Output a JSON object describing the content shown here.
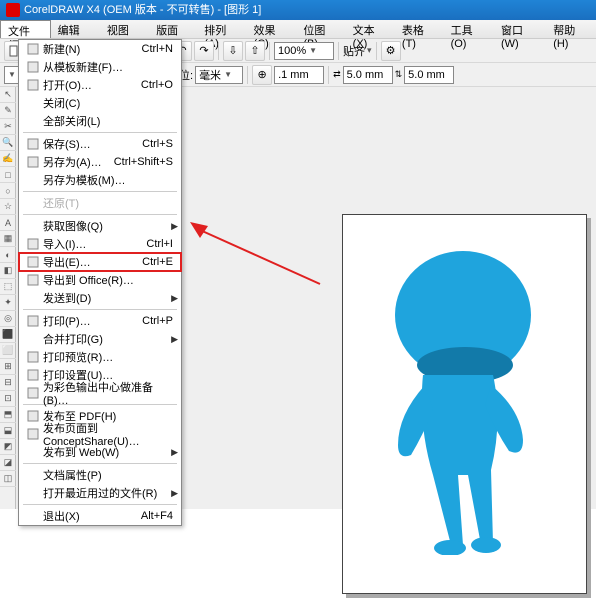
{
  "title": "CorelDRAW X4 (OEM 版本 - 不可转售) - [图形 1]",
  "menubar": [
    "文件(F)",
    "编辑(E)",
    "视图(V)",
    "版面(L)",
    "排列(A)",
    "效果(C)",
    "位图(B)",
    "文本(X)",
    "表格(T)",
    "工具(O)",
    "窗口(W)",
    "帮助(H)"
  ],
  "toolbar1": {
    "zoom": "100%",
    "align_label": "贴齐"
  },
  "toolbar2": {
    "unit_label": "单位:",
    "unit_value": "毫米",
    "nudge": ".1 mm",
    "dup_x": "5.0 mm",
    "dup_y": "5.0 mm"
  },
  "file_menu": [
    {
      "label": "新建(N)",
      "shortcut": "Ctrl+N",
      "icon": "new"
    },
    {
      "label": "从模板新建(F)…",
      "shortcut": "",
      "icon": "template"
    },
    {
      "label": "打开(O)…",
      "shortcut": "Ctrl+O",
      "icon": "open"
    },
    {
      "label": "关闭(C)",
      "shortcut": "",
      "icon": ""
    },
    {
      "label": "全部关闭(L)",
      "shortcut": "",
      "icon": ""
    },
    {
      "sep": true
    },
    {
      "label": "保存(S)…",
      "shortcut": "Ctrl+S",
      "icon": "save"
    },
    {
      "label": "另存为(A)…",
      "shortcut": "Ctrl+Shift+S",
      "icon": "saveas"
    },
    {
      "label": "另存为模板(M)…",
      "shortcut": "",
      "icon": ""
    },
    {
      "sep": true
    },
    {
      "label": "还原(T)",
      "shortcut": "",
      "icon": "",
      "disabled": true
    },
    {
      "sep": true
    },
    {
      "label": "获取图像(Q)",
      "shortcut": "",
      "icon": "",
      "sub": true
    },
    {
      "label": "导入(I)…",
      "shortcut": "Ctrl+I",
      "icon": "import"
    },
    {
      "label": "导出(E)…",
      "shortcut": "Ctrl+E",
      "icon": "export",
      "hl": true
    },
    {
      "label": "导出到 Office(R)…",
      "shortcut": "",
      "icon": "office"
    },
    {
      "label": "发送到(D)",
      "shortcut": "",
      "icon": "",
      "sub": true
    },
    {
      "sep": true
    },
    {
      "label": "打印(P)…",
      "shortcut": "Ctrl+P",
      "icon": "print"
    },
    {
      "label": "合并打印(G)",
      "shortcut": "",
      "icon": "",
      "sub": true
    },
    {
      "label": "打印预览(R)…",
      "shortcut": "",
      "icon": "preview"
    },
    {
      "label": "打印设置(U)…",
      "shortcut": "",
      "icon": "printsetup"
    },
    {
      "label": "为彩色输出中心做准备(B)…",
      "shortcut": "",
      "icon": "colorcenter"
    },
    {
      "sep": true
    },
    {
      "label": "发布至 PDF(H)",
      "shortcut": "",
      "icon": "pdf"
    },
    {
      "label": "发布页面到 ConceptShare(U)…",
      "shortcut": "",
      "icon": "cs"
    },
    {
      "label": "发布到 Web(W)",
      "shortcut": "",
      "icon": "",
      "sub": true
    },
    {
      "sep": true
    },
    {
      "label": "文档属性(P)",
      "shortcut": "",
      "icon": ""
    },
    {
      "label": "打开最近用过的文件(R)",
      "shortcut": "",
      "icon": "",
      "sub": true
    },
    {
      "sep": true
    },
    {
      "label": "退出(X)",
      "shortcut": "Alt+F4",
      "icon": ""
    }
  ]
}
